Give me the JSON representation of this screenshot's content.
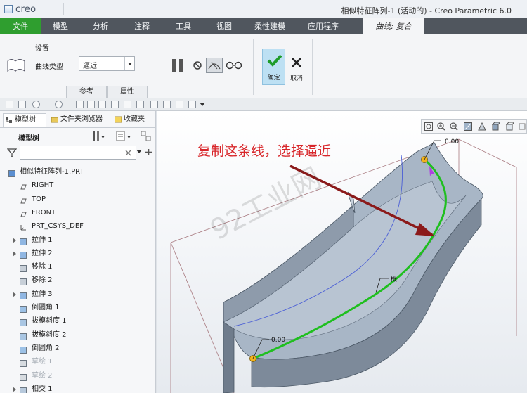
{
  "app": {
    "logo_text": "creo",
    "window_title": "相似特征阵列-1 (活动的) - Creo Parametric 6.0"
  },
  "menu": {
    "file": "文件",
    "items": [
      "模型",
      "分析",
      "注释",
      "工具",
      "视图",
      "柔性建模",
      "应用程序"
    ],
    "active_tab": "曲线: 复合"
  },
  "ribbon": {
    "group_label": "设置",
    "curve_type_label": "曲线类型",
    "curve_type_value": "逼近",
    "tab_reference": "参考",
    "tab_properties": "属性",
    "ok_label": "确定",
    "cancel_label": "取消"
  },
  "left_panel": {
    "tabs": [
      "模型树",
      "文件夹浏览器",
      "收藏夹"
    ],
    "tree_title": "模型树",
    "filter_placeholder": "",
    "items": [
      {
        "label": "相似特征阵列-1.PRT",
        "icon": "part-icon",
        "expandable": false,
        "dim": false
      },
      {
        "label": "RIGHT",
        "icon": "datum-plane-icon",
        "expandable": false,
        "dim": false
      },
      {
        "label": "TOP",
        "icon": "datum-plane-icon",
        "expandable": false,
        "dim": false
      },
      {
        "label": "FRONT",
        "icon": "datum-plane-icon",
        "expandable": false,
        "dim": false
      },
      {
        "label": "PRT_CSYS_DEF",
        "icon": "csys-icon",
        "expandable": false,
        "dim": false
      },
      {
        "label": "拉伸 1",
        "icon": "extrude-icon",
        "expandable": true,
        "dim": false
      },
      {
        "label": "拉伸 2",
        "icon": "extrude-icon",
        "expandable": true,
        "dim": false
      },
      {
        "label": "移除 1",
        "icon": "remove-icon",
        "expandable": false,
        "dim": false
      },
      {
        "label": "移除 2",
        "icon": "remove-icon",
        "expandable": false,
        "dim": false
      },
      {
        "label": "拉伸 3",
        "icon": "extrude-icon",
        "expandable": true,
        "dim": false
      },
      {
        "label": "倒圆角 1",
        "icon": "round-icon",
        "expandable": false,
        "dim": false
      },
      {
        "label": "拔模斜度 1",
        "icon": "draft-icon",
        "expandable": false,
        "dim": false
      },
      {
        "label": "拔模斜度 2",
        "icon": "draft-icon",
        "expandable": false,
        "dim": false
      },
      {
        "label": "倒圆角 2",
        "icon": "round-icon",
        "expandable": false,
        "dim": false
      },
      {
        "label": "草绘 1",
        "icon": "sketch-icon",
        "expandable": false,
        "dim": true
      },
      {
        "label": "草绘 2",
        "icon": "sketch-icon",
        "expandable": false,
        "dim": true
      },
      {
        "label": "相交 1",
        "icon": "intersect-icon",
        "expandable": true,
        "dim": false
      }
    ]
  },
  "viewport": {
    "annotation": "复制这条线，选择逼近",
    "watermark": "92工业网",
    "dim_top": "0.00",
    "dim_bottom": "0.00",
    "curve_tag": "概"
  },
  "colors": {
    "menu_bg": "#50565e",
    "file_green": "#2f9e2f",
    "curve_green": "#1fbf1f",
    "annotation_red": "#d8262a",
    "arrow_darkred": "#8b1a1a",
    "model_gray": "#7d8a9a"
  }
}
